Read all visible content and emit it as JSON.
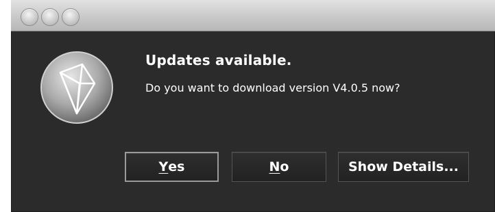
{
  "window": {
    "controls": [
      "close",
      "minimize",
      "zoom"
    ]
  },
  "dialog": {
    "icon": "diamond-app-icon",
    "title": "Updates available.",
    "message": "Do you want to download version V4.0.5 now?"
  },
  "buttons": {
    "yes": {
      "mnemonic": "Y",
      "rest": "es"
    },
    "no": {
      "mnemonic": "N",
      "rest": "o"
    },
    "details": {
      "label": "Show Details..."
    }
  },
  "colors": {
    "dialog_background": "#2b2b2b",
    "text": "#ffffff",
    "titlebar": "#c9c9c9"
  }
}
